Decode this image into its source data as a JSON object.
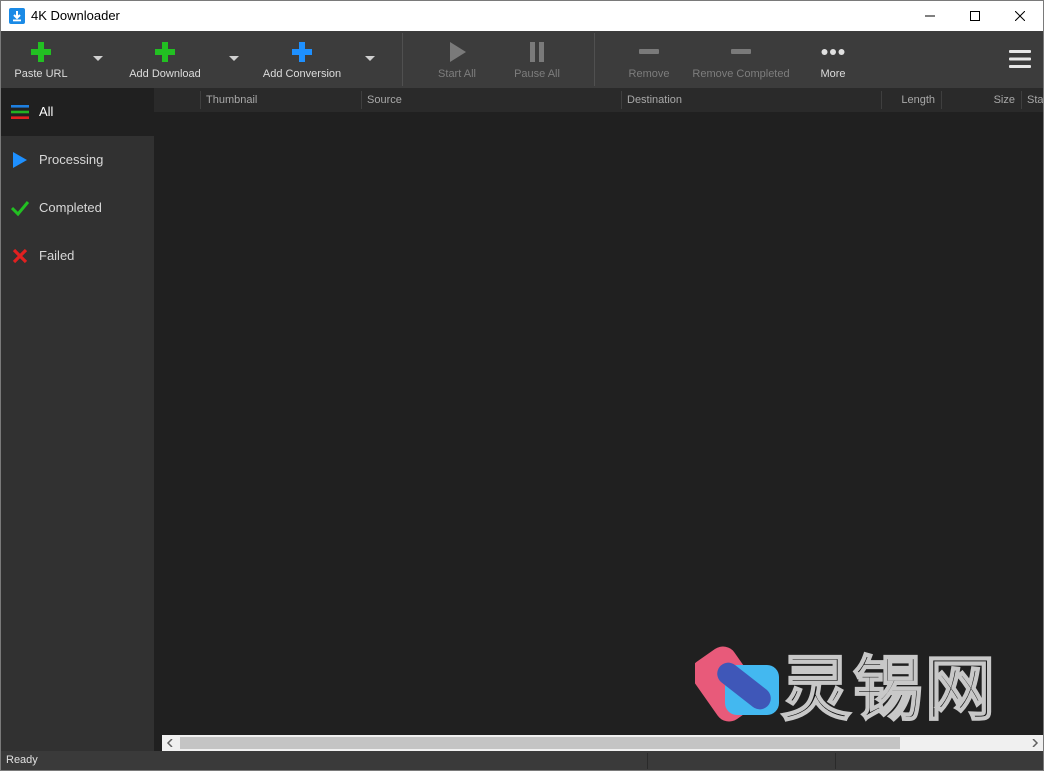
{
  "window": {
    "title": "4K Downloader",
    "controls": {
      "minimize": "minimize-icon",
      "maximize": "maximize-icon",
      "close": "close-icon"
    }
  },
  "toolbar": {
    "paste_url": {
      "label": "Paste URL",
      "icon": "plus-icon",
      "color": "#22c022"
    },
    "add_download": {
      "label": "Add Download",
      "icon": "plus-icon",
      "color": "#22c022"
    },
    "add_conversion": {
      "label": "Add Conversion",
      "icon": "plus-icon",
      "color": "#1e90ff"
    },
    "start_all": {
      "label": "Start All",
      "icon": "play-icon",
      "enabled": false
    },
    "pause_all": {
      "label": "Pause All",
      "icon": "pause-icon",
      "enabled": false
    },
    "remove": {
      "label": "Remove",
      "icon": "minus-icon",
      "enabled": false
    },
    "remove_completed": {
      "label": "Remove Completed",
      "icon": "minus-icon",
      "enabled": false
    },
    "more": {
      "label": "More",
      "icon": "more-dots-icon"
    },
    "menu": {
      "icon": "hamburger-menu-icon"
    }
  },
  "sidebar": {
    "items": [
      {
        "label": "All",
        "icon": "list-icon",
        "active": true
      },
      {
        "label": "Processing",
        "icon": "play-icon",
        "color": "#1e90ff"
      },
      {
        "label": "Completed",
        "icon": "checkmark-icon",
        "color": "#22c022"
      },
      {
        "label": "Failed",
        "icon": "cross-icon",
        "color": "#e02020"
      }
    ]
  },
  "table": {
    "columns": [
      "Thumbnail",
      "Source",
      "Destination",
      "Length",
      "Size",
      "Status"
    ],
    "rows": []
  },
  "statusbar": {
    "text": "Ready"
  },
  "watermark": {
    "text": "灵锡网"
  }
}
